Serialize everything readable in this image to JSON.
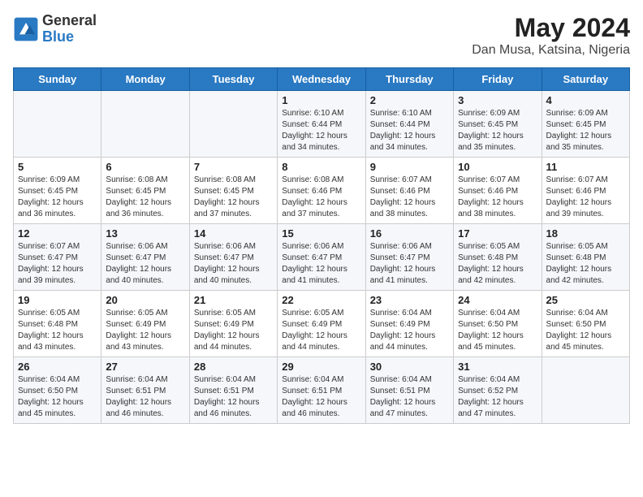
{
  "header": {
    "logo_general": "General",
    "logo_blue": "Blue",
    "month_year": "May 2024",
    "location": "Dan Musa, Katsina, Nigeria"
  },
  "days_of_week": [
    "Sunday",
    "Monday",
    "Tuesday",
    "Wednesday",
    "Thursday",
    "Friday",
    "Saturday"
  ],
  "weeks": [
    [
      {
        "day": "",
        "info": ""
      },
      {
        "day": "",
        "info": ""
      },
      {
        "day": "",
        "info": ""
      },
      {
        "day": "1",
        "info": "Sunrise: 6:10 AM\nSunset: 6:44 PM\nDaylight: 12 hours\nand 34 minutes."
      },
      {
        "day": "2",
        "info": "Sunrise: 6:10 AM\nSunset: 6:44 PM\nDaylight: 12 hours\nand 34 minutes."
      },
      {
        "day": "3",
        "info": "Sunrise: 6:09 AM\nSunset: 6:45 PM\nDaylight: 12 hours\nand 35 minutes."
      },
      {
        "day": "4",
        "info": "Sunrise: 6:09 AM\nSunset: 6:45 PM\nDaylight: 12 hours\nand 35 minutes."
      }
    ],
    [
      {
        "day": "5",
        "info": "Sunrise: 6:09 AM\nSunset: 6:45 PM\nDaylight: 12 hours\nand 36 minutes."
      },
      {
        "day": "6",
        "info": "Sunrise: 6:08 AM\nSunset: 6:45 PM\nDaylight: 12 hours\nand 36 minutes."
      },
      {
        "day": "7",
        "info": "Sunrise: 6:08 AM\nSunset: 6:45 PM\nDaylight: 12 hours\nand 37 minutes."
      },
      {
        "day": "8",
        "info": "Sunrise: 6:08 AM\nSunset: 6:46 PM\nDaylight: 12 hours\nand 37 minutes."
      },
      {
        "day": "9",
        "info": "Sunrise: 6:07 AM\nSunset: 6:46 PM\nDaylight: 12 hours\nand 38 minutes."
      },
      {
        "day": "10",
        "info": "Sunrise: 6:07 AM\nSunset: 6:46 PM\nDaylight: 12 hours\nand 38 minutes."
      },
      {
        "day": "11",
        "info": "Sunrise: 6:07 AM\nSunset: 6:46 PM\nDaylight: 12 hours\nand 39 minutes."
      }
    ],
    [
      {
        "day": "12",
        "info": "Sunrise: 6:07 AM\nSunset: 6:47 PM\nDaylight: 12 hours\nand 39 minutes."
      },
      {
        "day": "13",
        "info": "Sunrise: 6:06 AM\nSunset: 6:47 PM\nDaylight: 12 hours\nand 40 minutes."
      },
      {
        "day": "14",
        "info": "Sunrise: 6:06 AM\nSunset: 6:47 PM\nDaylight: 12 hours\nand 40 minutes."
      },
      {
        "day": "15",
        "info": "Sunrise: 6:06 AM\nSunset: 6:47 PM\nDaylight: 12 hours\nand 41 minutes."
      },
      {
        "day": "16",
        "info": "Sunrise: 6:06 AM\nSunset: 6:47 PM\nDaylight: 12 hours\nand 41 minutes."
      },
      {
        "day": "17",
        "info": "Sunrise: 6:05 AM\nSunset: 6:48 PM\nDaylight: 12 hours\nand 42 minutes."
      },
      {
        "day": "18",
        "info": "Sunrise: 6:05 AM\nSunset: 6:48 PM\nDaylight: 12 hours\nand 42 minutes."
      }
    ],
    [
      {
        "day": "19",
        "info": "Sunrise: 6:05 AM\nSunset: 6:48 PM\nDaylight: 12 hours\nand 43 minutes."
      },
      {
        "day": "20",
        "info": "Sunrise: 6:05 AM\nSunset: 6:49 PM\nDaylight: 12 hours\nand 43 minutes."
      },
      {
        "day": "21",
        "info": "Sunrise: 6:05 AM\nSunset: 6:49 PM\nDaylight: 12 hours\nand 44 minutes."
      },
      {
        "day": "22",
        "info": "Sunrise: 6:05 AM\nSunset: 6:49 PM\nDaylight: 12 hours\nand 44 minutes."
      },
      {
        "day": "23",
        "info": "Sunrise: 6:04 AM\nSunset: 6:49 PM\nDaylight: 12 hours\nand 44 minutes."
      },
      {
        "day": "24",
        "info": "Sunrise: 6:04 AM\nSunset: 6:50 PM\nDaylight: 12 hours\nand 45 minutes."
      },
      {
        "day": "25",
        "info": "Sunrise: 6:04 AM\nSunset: 6:50 PM\nDaylight: 12 hours\nand 45 minutes."
      }
    ],
    [
      {
        "day": "26",
        "info": "Sunrise: 6:04 AM\nSunset: 6:50 PM\nDaylight: 12 hours\nand 45 minutes."
      },
      {
        "day": "27",
        "info": "Sunrise: 6:04 AM\nSunset: 6:51 PM\nDaylight: 12 hours\nand 46 minutes."
      },
      {
        "day": "28",
        "info": "Sunrise: 6:04 AM\nSunset: 6:51 PM\nDaylight: 12 hours\nand 46 minutes."
      },
      {
        "day": "29",
        "info": "Sunrise: 6:04 AM\nSunset: 6:51 PM\nDaylight: 12 hours\nand 46 minutes."
      },
      {
        "day": "30",
        "info": "Sunrise: 6:04 AM\nSunset: 6:51 PM\nDaylight: 12 hours\nand 47 minutes."
      },
      {
        "day": "31",
        "info": "Sunrise: 6:04 AM\nSunset: 6:52 PM\nDaylight: 12 hours\nand 47 minutes."
      },
      {
        "day": "",
        "info": ""
      }
    ]
  ]
}
